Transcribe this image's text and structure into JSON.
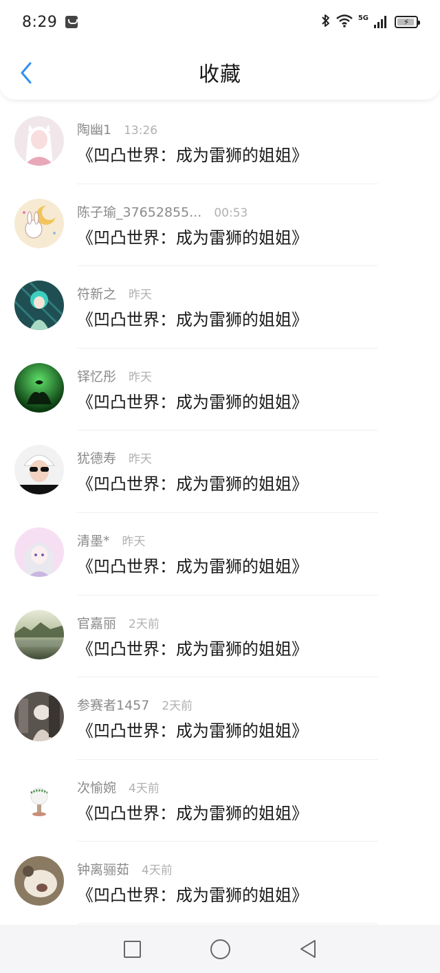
{
  "status_bar": {
    "time": "8:29",
    "network": "5G",
    "icons": [
      "message-icon",
      "bluetooth-icon",
      "wifi-icon",
      "signal-icon",
      "battery-charging-icon"
    ]
  },
  "header": {
    "title": "收藏",
    "back_icon": "chevron-left-icon",
    "accent_color": "#2f8ff3"
  },
  "items": [
    {
      "name": "陶幽1",
      "time": "13:26",
      "content": "《凹凸世界：成为雷狮的姐姐》",
      "avatar": "avatar-image"
    },
    {
      "name": "陈子瑜_37652855...",
      "time": "00:53",
      "content": "《凹凸世界：成为雷狮的姐姐》",
      "avatar": "avatar-image"
    },
    {
      "name": "符新之",
      "time": "昨天",
      "content": "《凹凸世界：成为雷狮的姐姐》",
      "avatar": "avatar-image"
    },
    {
      "name": "铎忆彤",
      "time": "昨天",
      "content": "《凹凸世界：成为雷狮的姐姐》",
      "avatar": "avatar-image"
    },
    {
      "name": "犹德寿",
      "time": "昨天",
      "content": "《凹凸世界：成为雷狮的姐姐》",
      "avatar": "avatar-image"
    },
    {
      "name": "清墨*",
      "time": "昨天",
      "content": "《凹凸世界：成为雷狮的姐姐》",
      "avatar": "avatar-image"
    },
    {
      "name": "官嘉丽",
      "time": "2天前",
      "content": "《凹凸世界：成为雷狮的姐姐》",
      "avatar": "avatar-image"
    },
    {
      "name": "参赛者1457",
      "time": "2天前",
      "content": "《凹凸世界：成为雷狮的姐姐》",
      "avatar": "avatar-image"
    },
    {
      "name": "次愉婉",
      "time": "4天前",
      "content": "《凹凸世界：成为雷狮的姐姐》",
      "avatar": "avatar-image"
    },
    {
      "name": "钟离骊茹",
      "time": "4天前",
      "content": "《凹凸世界：成为雷狮的姐姐》",
      "avatar": "avatar-image"
    }
  ],
  "nav_bar": {
    "buttons": [
      "recents-square-icon",
      "home-circle-icon",
      "back-triangle-icon"
    ]
  }
}
